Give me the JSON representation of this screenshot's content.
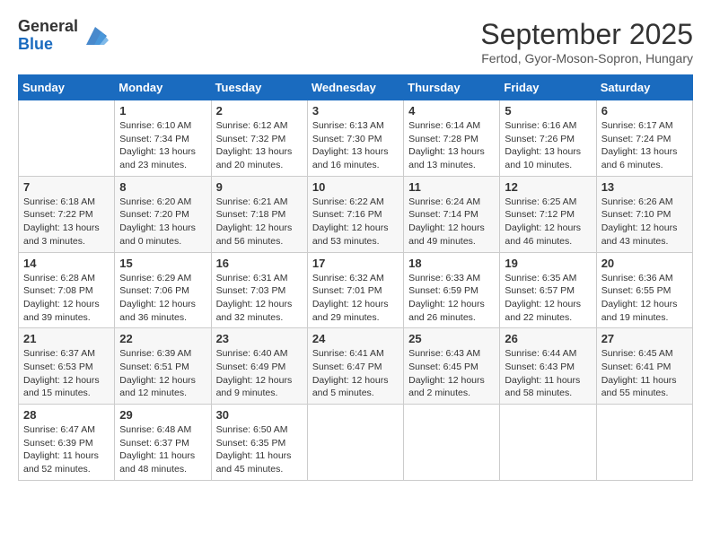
{
  "header": {
    "logo_general": "General",
    "logo_blue": "Blue",
    "month_title": "September 2025",
    "subtitle": "Fertod, Gyor-Moson-Sopron, Hungary"
  },
  "weekdays": [
    "Sunday",
    "Monday",
    "Tuesday",
    "Wednesday",
    "Thursday",
    "Friday",
    "Saturday"
  ],
  "weeks": [
    [
      {
        "day": "",
        "sunrise": "",
        "sunset": "",
        "daylight": ""
      },
      {
        "day": "1",
        "sunrise": "Sunrise: 6:10 AM",
        "sunset": "Sunset: 7:34 PM",
        "daylight": "Daylight: 13 hours and 23 minutes."
      },
      {
        "day": "2",
        "sunrise": "Sunrise: 6:12 AM",
        "sunset": "Sunset: 7:32 PM",
        "daylight": "Daylight: 13 hours and 20 minutes."
      },
      {
        "day": "3",
        "sunrise": "Sunrise: 6:13 AM",
        "sunset": "Sunset: 7:30 PM",
        "daylight": "Daylight: 13 hours and 16 minutes."
      },
      {
        "day": "4",
        "sunrise": "Sunrise: 6:14 AM",
        "sunset": "Sunset: 7:28 PM",
        "daylight": "Daylight: 13 hours and 13 minutes."
      },
      {
        "day": "5",
        "sunrise": "Sunrise: 6:16 AM",
        "sunset": "Sunset: 7:26 PM",
        "daylight": "Daylight: 13 hours and 10 minutes."
      },
      {
        "day": "6",
        "sunrise": "Sunrise: 6:17 AM",
        "sunset": "Sunset: 7:24 PM",
        "daylight": "Daylight: 13 hours and 6 minutes."
      }
    ],
    [
      {
        "day": "7",
        "sunrise": "Sunrise: 6:18 AM",
        "sunset": "Sunset: 7:22 PM",
        "daylight": "Daylight: 13 hours and 3 minutes."
      },
      {
        "day": "8",
        "sunrise": "Sunrise: 6:20 AM",
        "sunset": "Sunset: 7:20 PM",
        "daylight": "Daylight: 13 hours and 0 minutes."
      },
      {
        "day": "9",
        "sunrise": "Sunrise: 6:21 AM",
        "sunset": "Sunset: 7:18 PM",
        "daylight": "Daylight: 12 hours and 56 minutes."
      },
      {
        "day": "10",
        "sunrise": "Sunrise: 6:22 AM",
        "sunset": "Sunset: 7:16 PM",
        "daylight": "Daylight: 12 hours and 53 minutes."
      },
      {
        "day": "11",
        "sunrise": "Sunrise: 6:24 AM",
        "sunset": "Sunset: 7:14 PM",
        "daylight": "Daylight: 12 hours and 49 minutes."
      },
      {
        "day": "12",
        "sunrise": "Sunrise: 6:25 AM",
        "sunset": "Sunset: 7:12 PM",
        "daylight": "Daylight: 12 hours and 46 minutes."
      },
      {
        "day": "13",
        "sunrise": "Sunrise: 6:26 AM",
        "sunset": "Sunset: 7:10 PM",
        "daylight": "Daylight: 12 hours and 43 minutes."
      }
    ],
    [
      {
        "day": "14",
        "sunrise": "Sunrise: 6:28 AM",
        "sunset": "Sunset: 7:08 PM",
        "daylight": "Daylight: 12 hours and 39 minutes."
      },
      {
        "day": "15",
        "sunrise": "Sunrise: 6:29 AM",
        "sunset": "Sunset: 7:06 PM",
        "daylight": "Daylight: 12 hours and 36 minutes."
      },
      {
        "day": "16",
        "sunrise": "Sunrise: 6:31 AM",
        "sunset": "Sunset: 7:03 PM",
        "daylight": "Daylight: 12 hours and 32 minutes."
      },
      {
        "day": "17",
        "sunrise": "Sunrise: 6:32 AM",
        "sunset": "Sunset: 7:01 PM",
        "daylight": "Daylight: 12 hours and 29 minutes."
      },
      {
        "day": "18",
        "sunrise": "Sunrise: 6:33 AM",
        "sunset": "Sunset: 6:59 PM",
        "daylight": "Daylight: 12 hours and 26 minutes."
      },
      {
        "day": "19",
        "sunrise": "Sunrise: 6:35 AM",
        "sunset": "Sunset: 6:57 PM",
        "daylight": "Daylight: 12 hours and 22 minutes."
      },
      {
        "day": "20",
        "sunrise": "Sunrise: 6:36 AM",
        "sunset": "Sunset: 6:55 PM",
        "daylight": "Daylight: 12 hours and 19 minutes."
      }
    ],
    [
      {
        "day": "21",
        "sunrise": "Sunrise: 6:37 AM",
        "sunset": "Sunset: 6:53 PM",
        "daylight": "Daylight: 12 hours and 15 minutes."
      },
      {
        "day": "22",
        "sunrise": "Sunrise: 6:39 AM",
        "sunset": "Sunset: 6:51 PM",
        "daylight": "Daylight: 12 hours and 12 minutes."
      },
      {
        "day": "23",
        "sunrise": "Sunrise: 6:40 AM",
        "sunset": "Sunset: 6:49 PM",
        "daylight": "Daylight: 12 hours and 9 minutes."
      },
      {
        "day": "24",
        "sunrise": "Sunrise: 6:41 AM",
        "sunset": "Sunset: 6:47 PM",
        "daylight": "Daylight: 12 hours and 5 minutes."
      },
      {
        "day": "25",
        "sunrise": "Sunrise: 6:43 AM",
        "sunset": "Sunset: 6:45 PM",
        "daylight": "Daylight: 12 hours and 2 minutes."
      },
      {
        "day": "26",
        "sunrise": "Sunrise: 6:44 AM",
        "sunset": "Sunset: 6:43 PM",
        "daylight": "Daylight: 11 hours and 58 minutes."
      },
      {
        "day": "27",
        "sunrise": "Sunrise: 6:45 AM",
        "sunset": "Sunset: 6:41 PM",
        "daylight": "Daylight: 11 hours and 55 minutes."
      }
    ],
    [
      {
        "day": "28",
        "sunrise": "Sunrise: 6:47 AM",
        "sunset": "Sunset: 6:39 PM",
        "daylight": "Daylight: 11 hours and 52 minutes."
      },
      {
        "day": "29",
        "sunrise": "Sunrise: 6:48 AM",
        "sunset": "Sunset: 6:37 PM",
        "daylight": "Daylight: 11 hours and 48 minutes."
      },
      {
        "day": "30",
        "sunrise": "Sunrise: 6:50 AM",
        "sunset": "Sunset: 6:35 PM",
        "daylight": "Daylight: 11 hours and 45 minutes."
      },
      {
        "day": "",
        "sunrise": "",
        "sunset": "",
        "daylight": ""
      },
      {
        "day": "",
        "sunrise": "",
        "sunset": "",
        "daylight": ""
      },
      {
        "day": "",
        "sunrise": "",
        "sunset": "",
        "daylight": ""
      },
      {
        "day": "",
        "sunrise": "",
        "sunset": "",
        "daylight": ""
      }
    ]
  ]
}
